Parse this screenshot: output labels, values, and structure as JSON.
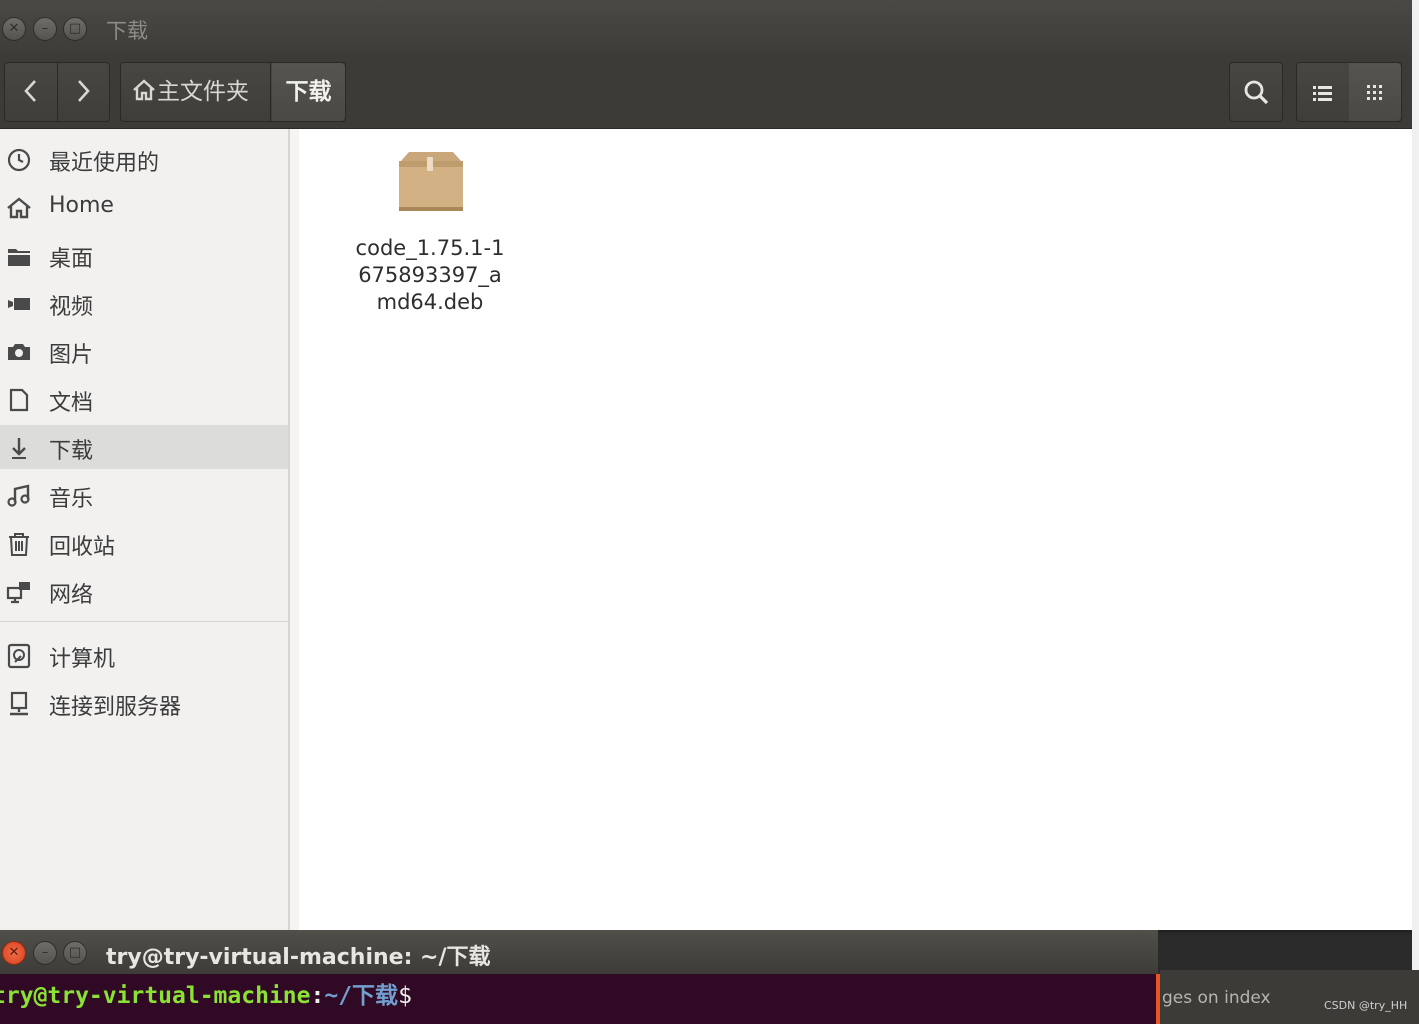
{
  "file_manager": {
    "title": "下载",
    "breadcrumb": {
      "home": "主文件夹",
      "current": "下载"
    },
    "sidebar": {
      "items": [
        {
          "label": "最近使用的",
          "icon": "clock-icon"
        },
        {
          "label": "Home",
          "icon": "home-icon"
        },
        {
          "label": "桌面",
          "icon": "folder-icon"
        },
        {
          "label": "视频",
          "icon": "video-icon"
        },
        {
          "label": "图片",
          "icon": "camera-icon"
        },
        {
          "label": "文档",
          "icon": "document-icon"
        },
        {
          "label": "下载",
          "icon": "download-icon",
          "active": true
        },
        {
          "label": "音乐",
          "icon": "music-icon"
        },
        {
          "label": "回收站",
          "icon": "trash-icon"
        },
        {
          "label": "网络",
          "icon": "network-icon"
        }
      ],
      "devices": [
        {
          "label": "计算机",
          "icon": "computer-icon"
        },
        {
          "label": "连接到服务器",
          "icon": "server-icon"
        }
      ]
    },
    "files": [
      {
        "name": "code_1.75.1-1675893397_amd64.deb",
        "icon": "package-icon"
      }
    ]
  },
  "terminal": {
    "title": "try@try-virtual-machine: ~/下载",
    "prompt_user": "try@try-virtual-machine",
    "prompt_colon": ":",
    "prompt_path": "~/下载",
    "prompt_dollar": "$"
  },
  "background": {
    "text_fragment": "ges on index",
    "watermark": "CSDN @try_HH"
  },
  "colors": {
    "terminal_bg": "#300a24",
    "prompt_user": "#8ae234",
    "prompt_path": "#729fcf",
    "accent": "#e95420"
  }
}
